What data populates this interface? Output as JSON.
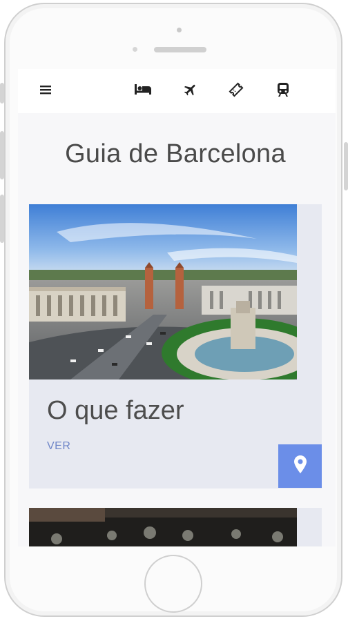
{
  "colors": {
    "accent": "#6b8ee8",
    "link": "#6f86c8",
    "card_background": "#e7e9f1"
  },
  "topbar": {
    "icons": [
      "menu-icon",
      "bed-icon",
      "airplane-icon",
      "ticket-icon",
      "train-icon"
    ]
  },
  "page": {
    "title": "Guia de Barcelona"
  },
  "cards": [
    {
      "title": "O que fazer",
      "link_label": "VER",
      "fab_icon": "location-pin-icon"
    }
  ]
}
